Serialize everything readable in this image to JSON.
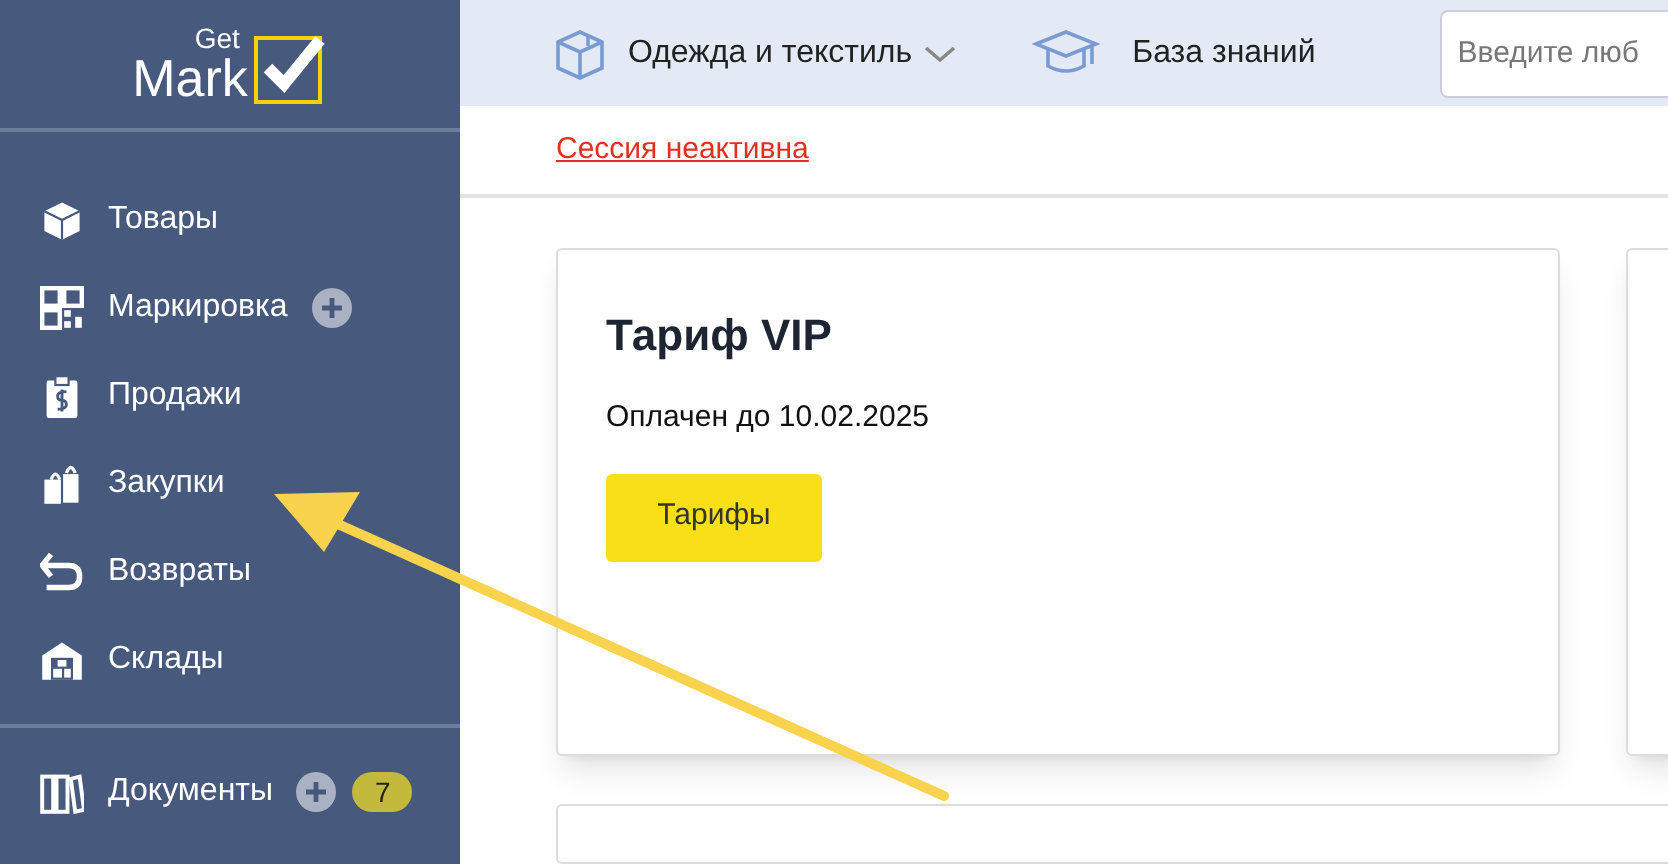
{
  "logo": {
    "small": "Get",
    "big": "Mark"
  },
  "sidebar": {
    "groups": [
      [
        {
          "label": "Товары",
          "add": false
        },
        {
          "label": "Маркировка",
          "add": true
        },
        {
          "label": "Продажи",
          "add": false
        },
        {
          "label": "Закупки",
          "add": false
        },
        {
          "label": "Возвраты",
          "add": false
        },
        {
          "label": "Склады",
          "add": false
        }
      ],
      [
        {
          "label": "Документы",
          "add": true,
          "badge": "7"
        }
      ]
    ]
  },
  "topbar": {
    "category": "Одежда и текстиль",
    "knowledge": "База знаний",
    "search": {
      "placeholder": "Введите люб"
    }
  },
  "session_link": "Сессия неактивна",
  "tariff_card": {
    "title": "Тариф VIP",
    "paid_until": "Оплачен до 10.02.2025",
    "button": "Тарифы"
  }
}
